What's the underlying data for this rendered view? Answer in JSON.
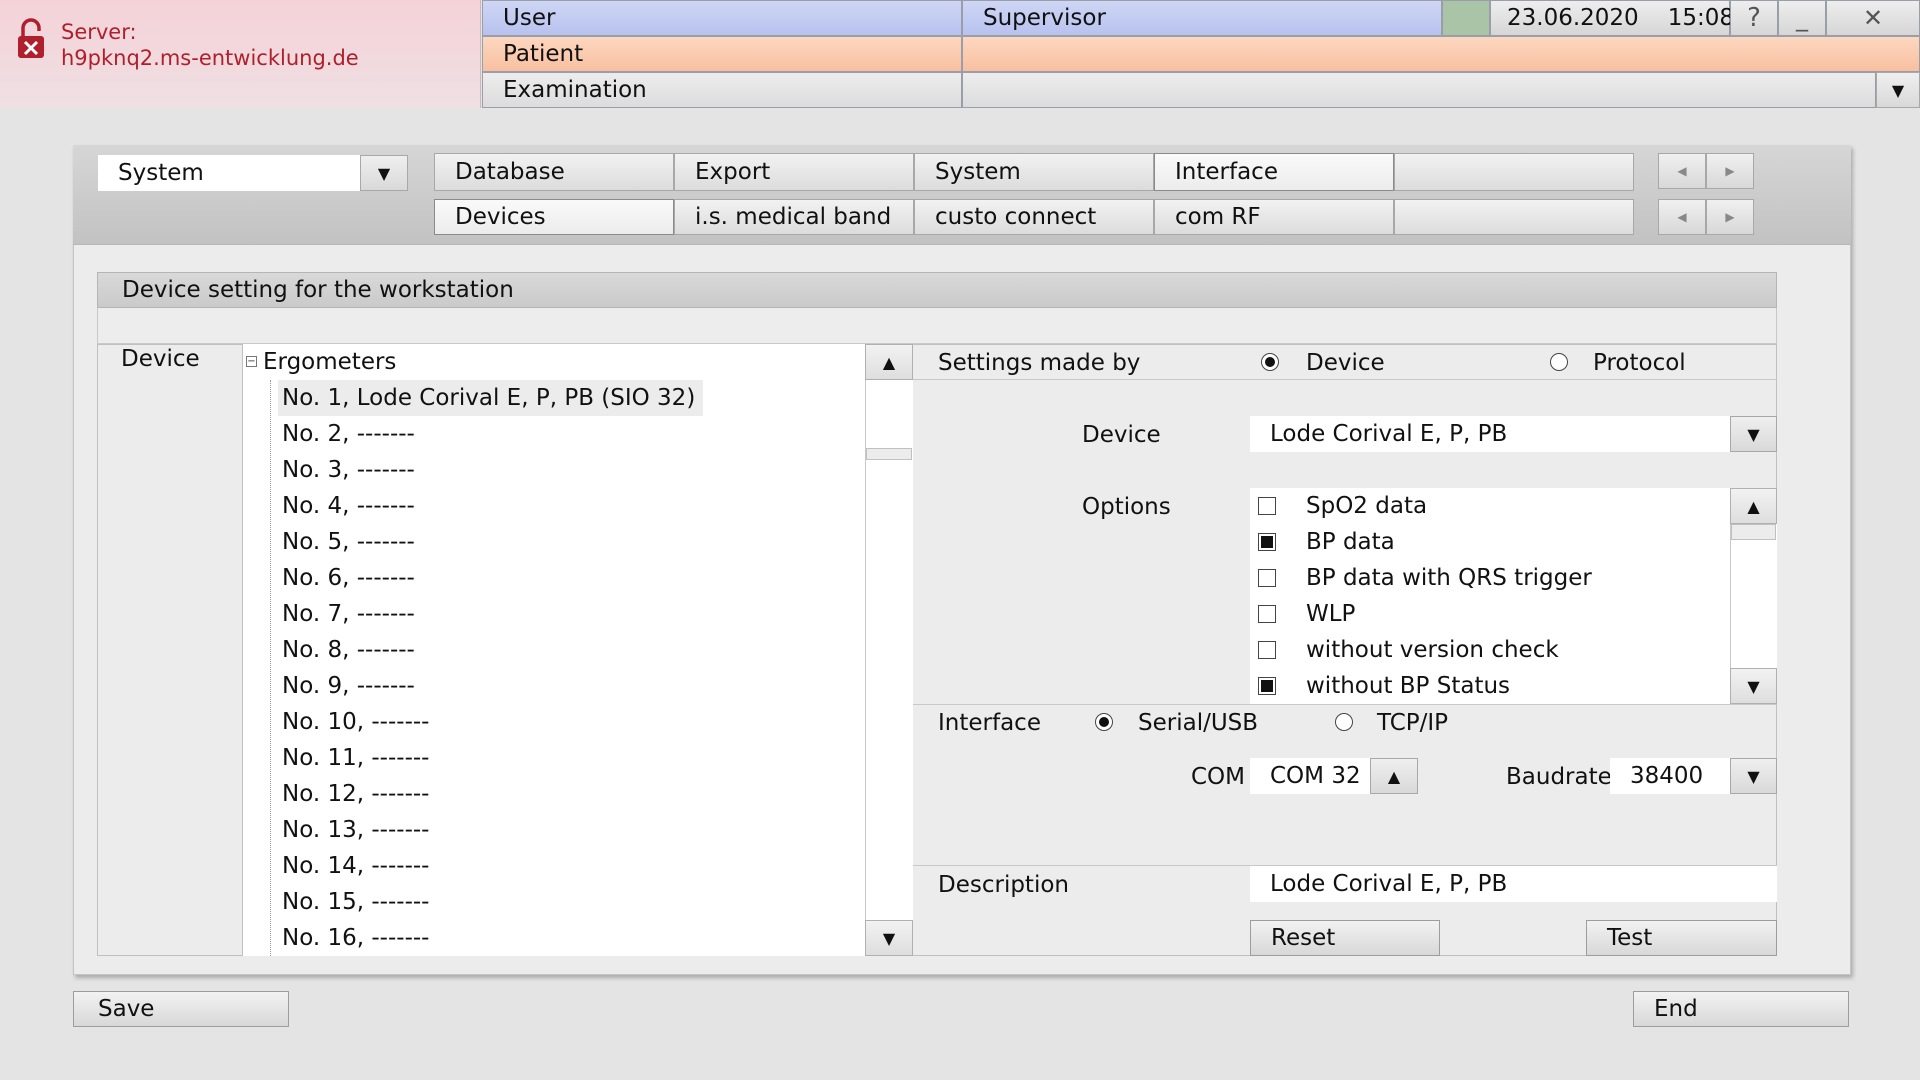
{
  "server": {
    "label": "Server:",
    "host": "h9pknq2.ms-entwicklung.de"
  },
  "header": {
    "user_label": "User",
    "user_value": "Supervisor",
    "patient_label": "Patient",
    "examination_label": "Examination",
    "date": "23.06.2020",
    "time": "15:08",
    "help": "?",
    "minimize": "_",
    "close": "✕"
  },
  "module_select": {
    "value": "System"
  },
  "tabs_row1": [
    "Database",
    "Export",
    "System",
    "Interface"
  ],
  "tabs_row2": [
    "Devices",
    "i.s. medical band",
    "custo connect",
    "com RF"
  ],
  "section": {
    "title": "Device setting for the workstation"
  },
  "device_label": "Device",
  "tree": {
    "root": "Ergometers",
    "items": [
      "No. 1,  Lode Corival E, P, PB   (SIO 32)",
      "No. 2,  -------",
      "No. 3,  -------",
      "No. 4,  -------",
      "No. 5,  -------",
      "No. 6,  -------",
      "No. 7,  -------",
      "No. 8,  -------",
      "No. 9,  -------",
      "No. 10,  -------",
      "No. 11,  -------",
      "No. 12,  -------",
      "No. 13,  -------",
      "No. 14,  -------",
      "No. 15,  -------",
      "No. 16,  -------"
    ]
  },
  "settings": {
    "made_by_label": "Settings made by",
    "opt_device": "Device",
    "opt_protocol": "Protocol",
    "device_label": "Device",
    "device_value": "Lode Corival E, P, PB",
    "options_label": "Options",
    "options": [
      {
        "label": "SpO2 data",
        "checked": false
      },
      {
        "label": "BP data",
        "checked": true
      },
      {
        "label": "BP data with QRS trigger",
        "checked": false
      },
      {
        "label": "WLP",
        "checked": false
      },
      {
        "label": "without version check",
        "checked": false
      },
      {
        "label": "without BP Status",
        "checked": true
      }
    ],
    "interface_label": "Interface",
    "if_serial": "Serial/USB",
    "if_tcp": "TCP/IP",
    "com_label": "COM",
    "com_value": "COM 32",
    "baud_label": "Baudrate",
    "baud_value": "38400",
    "description_label": "Description",
    "description_value": "Lode Corival E, P, PB",
    "reset": "Reset",
    "test": "Test"
  },
  "footer": {
    "save": "Save",
    "end": "End"
  }
}
